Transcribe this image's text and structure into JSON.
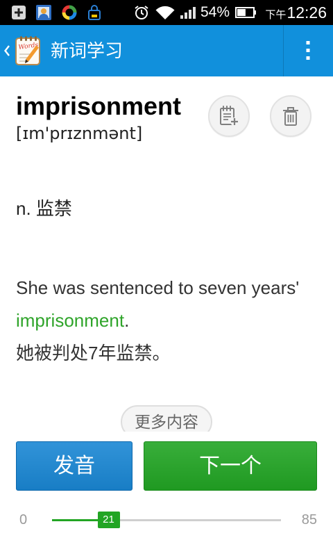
{
  "status_bar": {
    "left_icons": [
      "add-box-icon",
      "contacts-icon",
      "security-app-icon",
      "shopping-bag-icon"
    ],
    "right_icons": [
      "alarm-icon",
      "wifi-icon",
      "signal-icon",
      "battery-icon"
    ],
    "battery": "54%",
    "period": "下午",
    "time": "12:26"
  },
  "app_bar": {
    "color": "#1190dc",
    "back_icon": "chevron-left-icon",
    "logo_text": "Words",
    "title": "新词学习",
    "menu_icon": "more-vert-icon"
  },
  "word": {
    "headword": "imprisonment",
    "phonetic": "[ɪm'prɪznmənt]",
    "add_icon": "notebook-add-icon",
    "delete_icon": "trash-icon"
  },
  "definition": "n. 监禁",
  "example": {
    "sentence": "She was sentenced to seven years'",
    "keyword": "imprisonment",
    "punctuation": ".",
    "translation": "她被判处7年监禁。",
    "keyword_color": "#2fa42a"
  },
  "more_button": {
    "label": "更多内容"
  },
  "actions": {
    "pronounce_label": "发音",
    "pronounce_color": "#1a87d4",
    "next_label": "下一个",
    "next_color": "#22a524"
  },
  "progress": {
    "min": 0,
    "max": 85,
    "current": 21,
    "color": "#22a524"
  }
}
